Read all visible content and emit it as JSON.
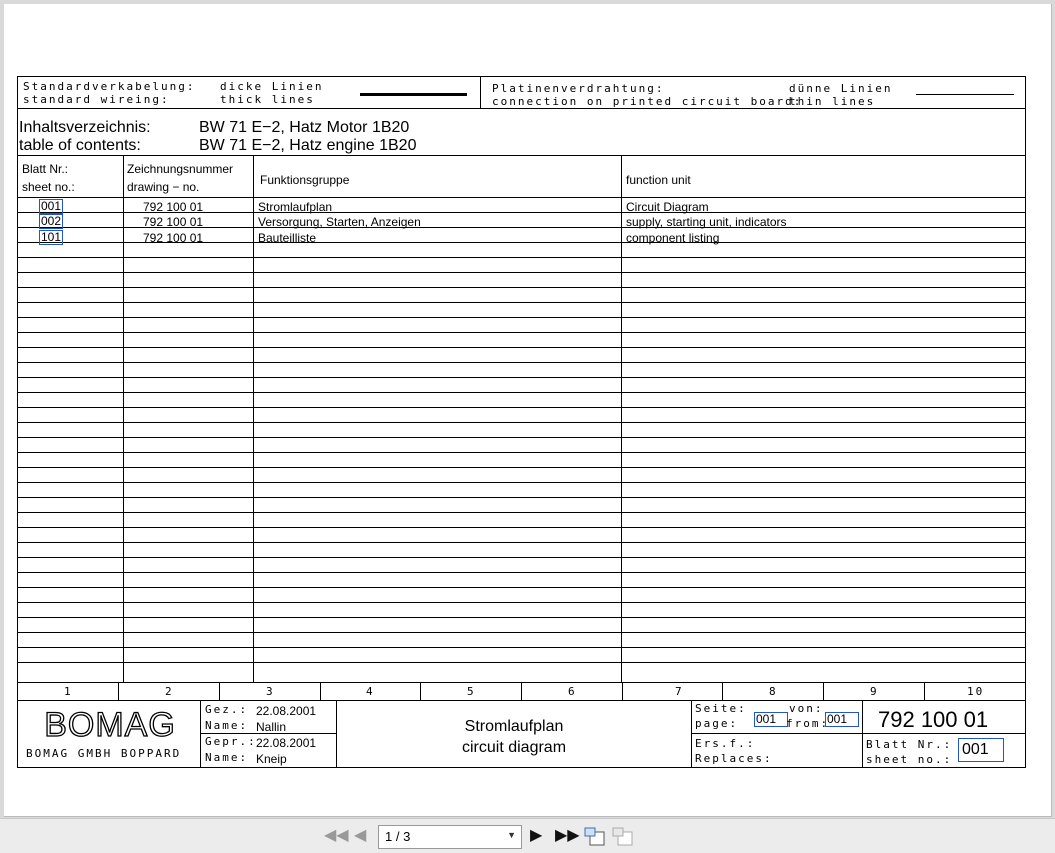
{
  "legend": {
    "standard_de": "Standardverkabelung:",
    "standard_en": "standard wireing:",
    "thick_de": "dicke Linien",
    "thick_en": "thick lines",
    "pcb_de": "Platinenverdrahtung:",
    "pcb_en": "connection on printed circuit board:",
    "thin_de": "dünne Linien",
    "thin_en": "thin lines"
  },
  "heading": {
    "toc_de": "Inhaltsverzeichnis:",
    "toc_en": "table of contents:",
    "machine_de": "BW 71 E−2, Hatz Motor 1B20",
    "machine_en": "BW 71 E−2, Hatz engine 1B20"
  },
  "columns": {
    "sheet_de": "Blatt Nr.:",
    "sheet_en": "sheet no.:",
    "drawing_de": "Zeichnungsnummer",
    "drawing_en": "drawing − no.",
    "group_de": "Funktionsgruppe",
    "unit_en": "function unit"
  },
  "rows": [
    {
      "sheet": "001",
      "drawing": "792 100 01",
      "group": "Stromlaufplan",
      "unit": "Circuit Diagram"
    },
    {
      "sheet": "002",
      "drawing": "792 100 01",
      "group": "Versorgung, Starten, Anzeigen",
      "unit": "supply, starting unit, indicators"
    },
    {
      "sheet": "101",
      "drawing": "792 100 01",
      "group": "Bauteilliste",
      "unit": "component listing"
    }
  ],
  "grid_numbers": [
    "1",
    "2",
    "3",
    "4",
    "5",
    "6",
    "7",
    "8",
    "9",
    "10"
  ],
  "title_block": {
    "logo": "BOMAG",
    "company": "BOMAG GMBH BOPPARD",
    "drawn_label": "Gez.:",
    "drawn_date": "22.08.2001",
    "drawn_name_label": "Name:",
    "drawn_name": "Nallin",
    "checked_label": "Gepr.:",
    "checked_date": "22.08.2001",
    "checked_name_label": "Name:",
    "checked_name": "Kneip",
    "title_de": "Stromlaufplan",
    "title_en": "circuit diagram",
    "seite_label": "Seite:",
    "page_label": "page:",
    "page_value": "001",
    "von_label": "von:",
    "from_label": "from:",
    "from_value": "001",
    "drawing_number": "792 100 01",
    "ersf_label": "Ers.f.:",
    "replaces_label": "Replaces:",
    "blatt_label": "Blatt Nr.:",
    "sheetno_label": "sheet no.:",
    "sheet_value": "001"
  },
  "viewer": {
    "page_indicator": "1 / 3"
  }
}
